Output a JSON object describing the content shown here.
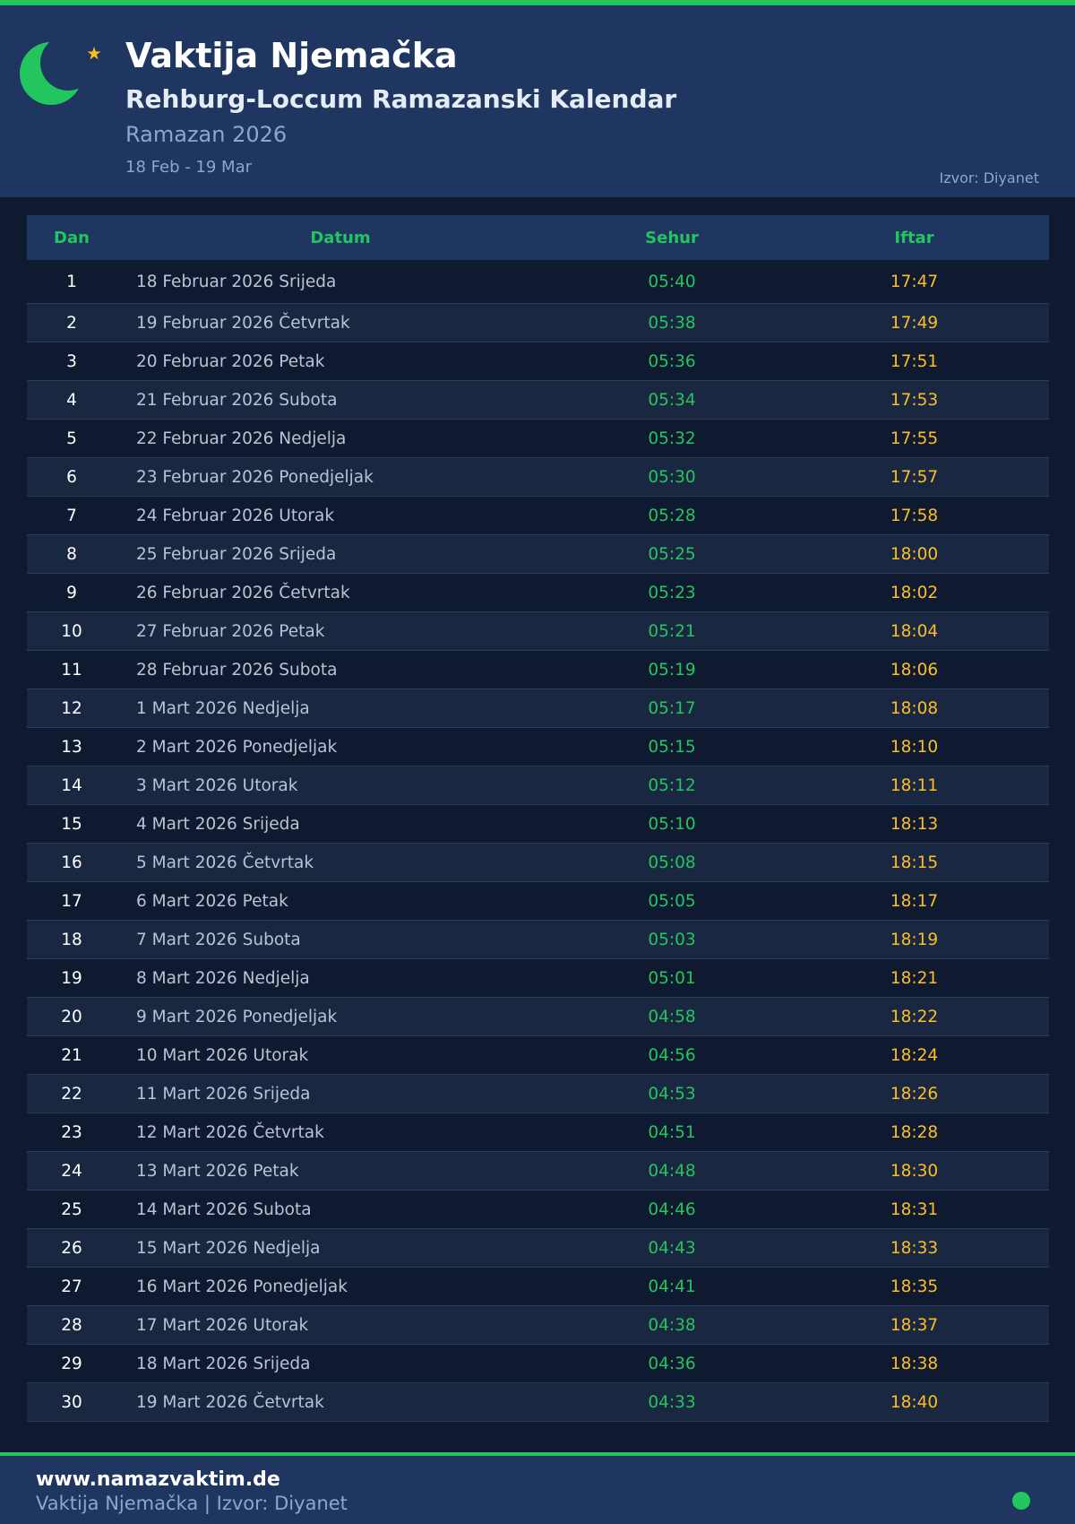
{
  "header": {
    "title": "Vaktija Njemačka",
    "subtitle": "Rehburg-Loccum Ramazanski Kalendar",
    "period": "Ramazan 2026",
    "dates": "18 Feb - 19 Mar",
    "source": "Izvor: Diyanet",
    "logo_icon": "crescent-star-icon"
  },
  "table": {
    "columns": [
      "Dan",
      "Datum",
      "Sehur",
      "Iftar"
    ],
    "rows": [
      {
        "dan": "1",
        "datum": "18 Februar 2026 Srijeda",
        "sehur": "05:40",
        "iftar": "17:47"
      },
      {
        "dan": "2",
        "datum": "19 Februar 2026 Četvrtak",
        "sehur": "05:38",
        "iftar": "17:49"
      },
      {
        "dan": "3",
        "datum": "20 Februar 2026 Petak",
        "sehur": "05:36",
        "iftar": "17:51"
      },
      {
        "dan": "4",
        "datum": "21 Februar 2026 Subota",
        "sehur": "05:34",
        "iftar": "17:53"
      },
      {
        "dan": "5",
        "datum": "22 Februar 2026 Nedjelja",
        "sehur": "05:32",
        "iftar": "17:55"
      },
      {
        "dan": "6",
        "datum": "23 Februar 2026 Ponedjeljak",
        "sehur": "05:30",
        "iftar": "17:57"
      },
      {
        "dan": "7",
        "datum": "24 Februar 2026 Utorak",
        "sehur": "05:28",
        "iftar": "17:58"
      },
      {
        "dan": "8",
        "datum": "25 Februar 2026 Srijeda",
        "sehur": "05:25",
        "iftar": "18:00"
      },
      {
        "dan": "9",
        "datum": "26 Februar 2026 Četvrtak",
        "sehur": "05:23",
        "iftar": "18:02"
      },
      {
        "dan": "10",
        "datum": "27 Februar 2026 Petak",
        "sehur": "05:21",
        "iftar": "18:04"
      },
      {
        "dan": "11",
        "datum": "28 Februar 2026 Subota",
        "sehur": "05:19",
        "iftar": "18:06"
      },
      {
        "dan": "12",
        "datum": "1 Mart 2026 Nedjelja",
        "sehur": "05:17",
        "iftar": "18:08"
      },
      {
        "dan": "13",
        "datum": "2 Mart 2026 Ponedjeljak",
        "sehur": "05:15",
        "iftar": "18:10"
      },
      {
        "dan": "14",
        "datum": "3 Mart 2026 Utorak",
        "sehur": "05:12",
        "iftar": "18:11"
      },
      {
        "dan": "15",
        "datum": "4 Mart 2026 Srijeda",
        "sehur": "05:10",
        "iftar": "18:13"
      },
      {
        "dan": "16",
        "datum": "5 Mart 2026 Četvrtak",
        "sehur": "05:08",
        "iftar": "18:15"
      },
      {
        "dan": "17",
        "datum": "6 Mart 2026 Petak",
        "sehur": "05:05",
        "iftar": "18:17"
      },
      {
        "dan": "18",
        "datum": "7 Mart 2026 Subota",
        "sehur": "05:03",
        "iftar": "18:19"
      },
      {
        "dan": "19",
        "datum": "8 Mart 2026 Nedjelja",
        "sehur": "05:01",
        "iftar": "18:21"
      },
      {
        "dan": "20",
        "datum": "9 Mart 2026 Ponedjeljak",
        "sehur": "04:58",
        "iftar": "18:22"
      },
      {
        "dan": "21",
        "datum": "10 Mart 2026 Utorak",
        "sehur": "04:56",
        "iftar": "18:24"
      },
      {
        "dan": "22",
        "datum": "11 Mart 2026 Srijeda",
        "sehur": "04:53",
        "iftar": "18:26"
      },
      {
        "dan": "23",
        "datum": "12 Mart 2026 Četvrtak",
        "sehur": "04:51",
        "iftar": "18:28"
      },
      {
        "dan": "24",
        "datum": "13 Mart 2026 Petak",
        "sehur": "04:48",
        "iftar": "18:30"
      },
      {
        "dan": "25",
        "datum": "14 Mart 2026 Subota",
        "sehur": "04:46",
        "iftar": "18:31"
      },
      {
        "dan": "26",
        "datum": "15 Mart 2026 Nedjelja",
        "sehur": "04:43",
        "iftar": "18:33"
      },
      {
        "dan": "27",
        "datum": "16 Mart 2026 Ponedjeljak",
        "sehur": "04:41",
        "iftar": "18:35"
      },
      {
        "dan": "28",
        "datum": "17 Mart 2026 Utorak",
        "sehur": "04:38",
        "iftar": "18:37"
      },
      {
        "dan": "29",
        "datum": "18 Mart 2026 Srijeda",
        "sehur": "04:36",
        "iftar": "18:38"
      },
      {
        "dan": "30",
        "datum": "19 Mart 2026 Četvrtak",
        "sehur": "04:33",
        "iftar": "18:40"
      }
    ]
  },
  "footer": {
    "site": "www.namazvaktim.de",
    "info": "Vaktija Njemačka | Izvor: Diyanet",
    "status_icon": "status-dot-icon"
  },
  "colors": {
    "accent_green": "#22c55e",
    "iftar_gold": "#fbbf24",
    "header_bg": "#1f3760",
    "page_bg": "#0f1a30"
  }
}
